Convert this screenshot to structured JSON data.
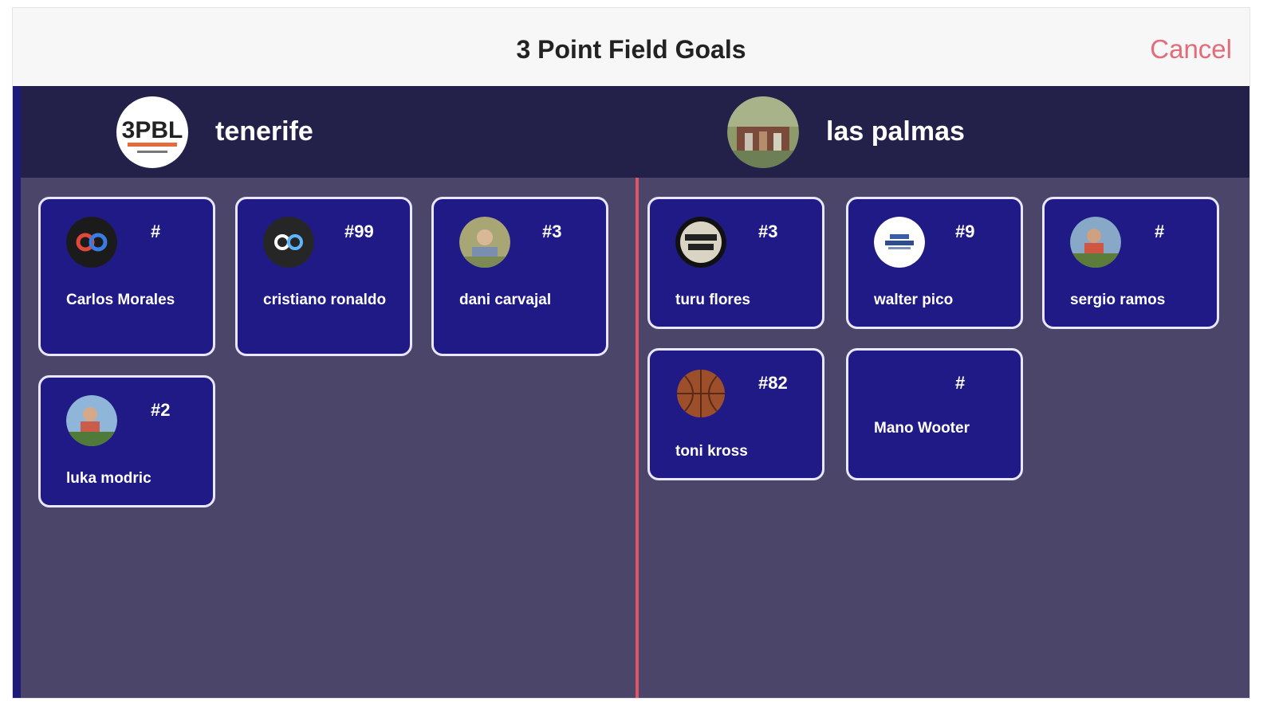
{
  "header": {
    "title": "3 Point Field Goals",
    "cancel_label": "Cancel"
  },
  "teams": [
    {
      "name": "tenerife",
      "logo_text": "3PBL",
      "players": [
        {
          "number": "#",
          "name": "Carlos Morales",
          "avatar": "infinity-logo"
        },
        {
          "number": "#99",
          "name": "cristiano ronaldo",
          "avatar": "infinity-logo"
        },
        {
          "number": "#3",
          "name": "dani carvajal",
          "avatar": "photo"
        },
        {
          "number": "#2",
          "name": "luka modric",
          "avatar": "photo"
        }
      ]
    },
    {
      "name": "las palmas",
      "logo_text": "",
      "players": [
        {
          "number": "#3",
          "name": "turu flores",
          "avatar": "badge-logo"
        },
        {
          "number": "#9",
          "name": "walter pico",
          "avatar": "white-logo"
        },
        {
          "number": "#",
          "name": "sergio ramos",
          "avatar": "photo"
        },
        {
          "number": "#82",
          "name": "toni kross",
          "avatar": "basketball"
        },
        {
          "number": "#",
          "name": "Mano Wooter",
          "avatar": "none"
        }
      ]
    }
  ],
  "colors": {
    "accent_cancel": "#e46b7a",
    "card_bg": "#201a87",
    "card_border": "#e9e6ff",
    "panel_bg": "#4a4569",
    "team_header_bg": "#23214a",
    "divider": "#e05565"
  }
}
